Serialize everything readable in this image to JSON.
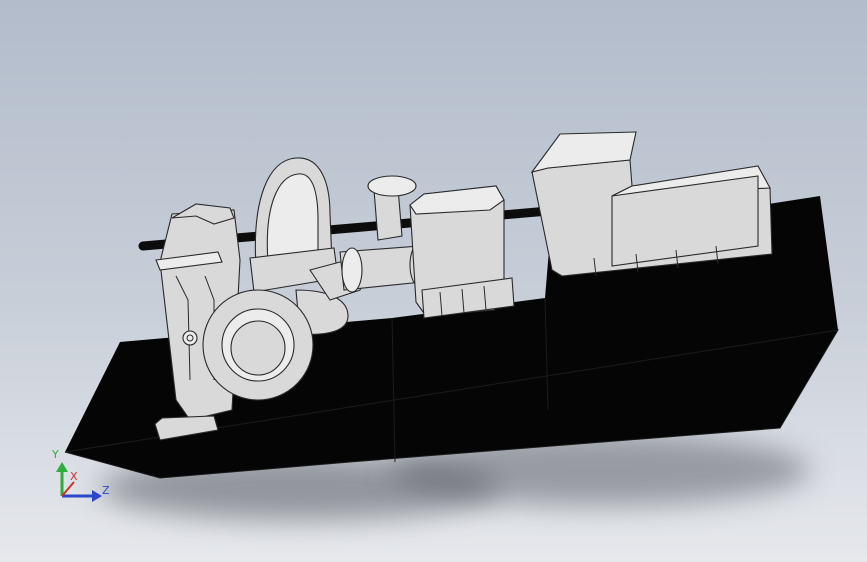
{
  "viewport": {
    "background_top": "#b2bccb",
    "background_bottom": "#e6e8ec"
  },
  "model": {
    "base_color": "#050505",
    "part_fill": "#d9d9d9",
    "part_fill_light": "#ececec",
    "part_shade": "#a8a8a8",
    "edge_color": "#2a2a2a",
    "shaft_color": "#0c0c0c"
  },
  "triad": {
    "y_label": "Y",
    "x_label": "X",
    "z_label": "Z",
    "y_color": "#2fae3a",
    "x_color": "#c8322d",
    "z_color": "#2c47c9"
  }
}
